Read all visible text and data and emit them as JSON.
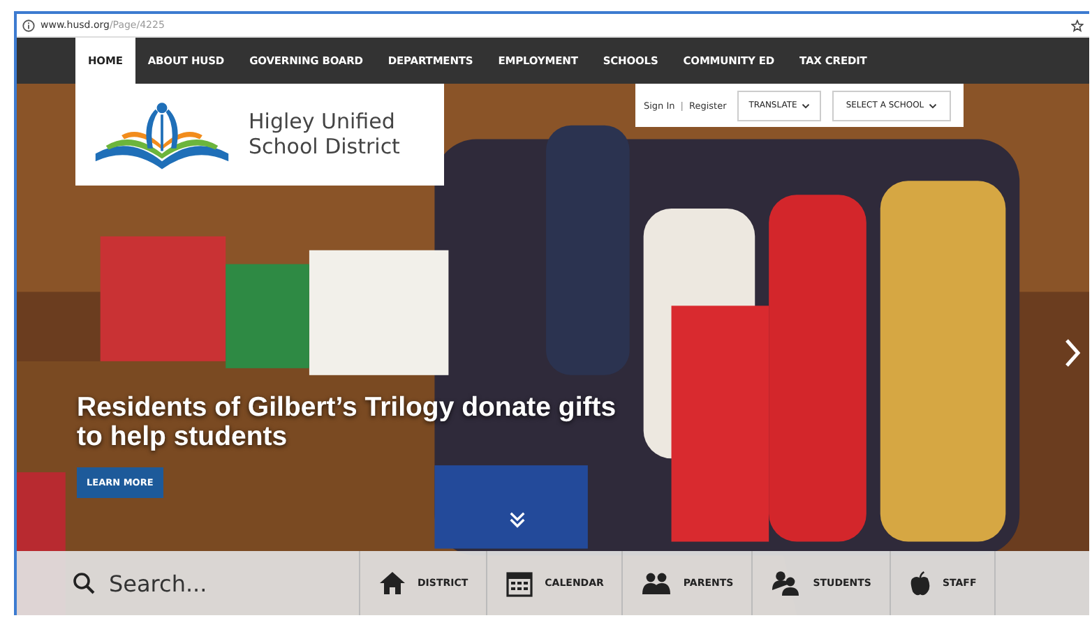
{
  "browser": {
    "url_host": "www.husd.org",
    "url_path": "/Page/4225"
  },
  "nav": [
    {
      "label": "HOME",
      "selected": true
    },
    {
      "label": "ABOUT HUSD",
      "selected": false
    },
    {
      "label": "GOVERNING BOARD",
      "selected": false
    },
    {
      "label": "DEPARTMENTS",
      "selected": false
    },
    {
      "label": "EMPLOYMENT",
      "selected": false
    },
    {
      "label": "SCHOOLS",
      "selected": false
    },
    {
      "label": "COMMUNITY ED",
      "selected": false
    },
    {
      "label": "TAX CREDIT",
      "selected": false
    }
  ],
  "logo": {
    "line1": "Higley Unified",
    "line2": "School District"
  },
  "account": {
    "sign_in": "Sign In",
    "separator": "|",
    "register": "Register",
    "translate": "TRANSLATE",
    "select_school": "SELECT A SCHOOL"
  },
  "hero": {
    "headline": "Residents of Gilbert’s Trilogy donate gifts to help students",
    "button": "LEARN MORE"
  },
  "search": {
    "placeholder": "Search..."
  },
  "quick_links": [
    {
      "kind": "house",
      "label": "DISTRICT"
    },
    {
      "kind": "calendar",
      "label": "CALENDAR"
    },
    {
      "kind": "parents",
      "label": "PARENTS"
    },
    {
      "kind": "students",
      "label": "STUDENTS"
    },
    {
      "kind": "apple",
      "label": "STAFF"
    }
  ]
}
